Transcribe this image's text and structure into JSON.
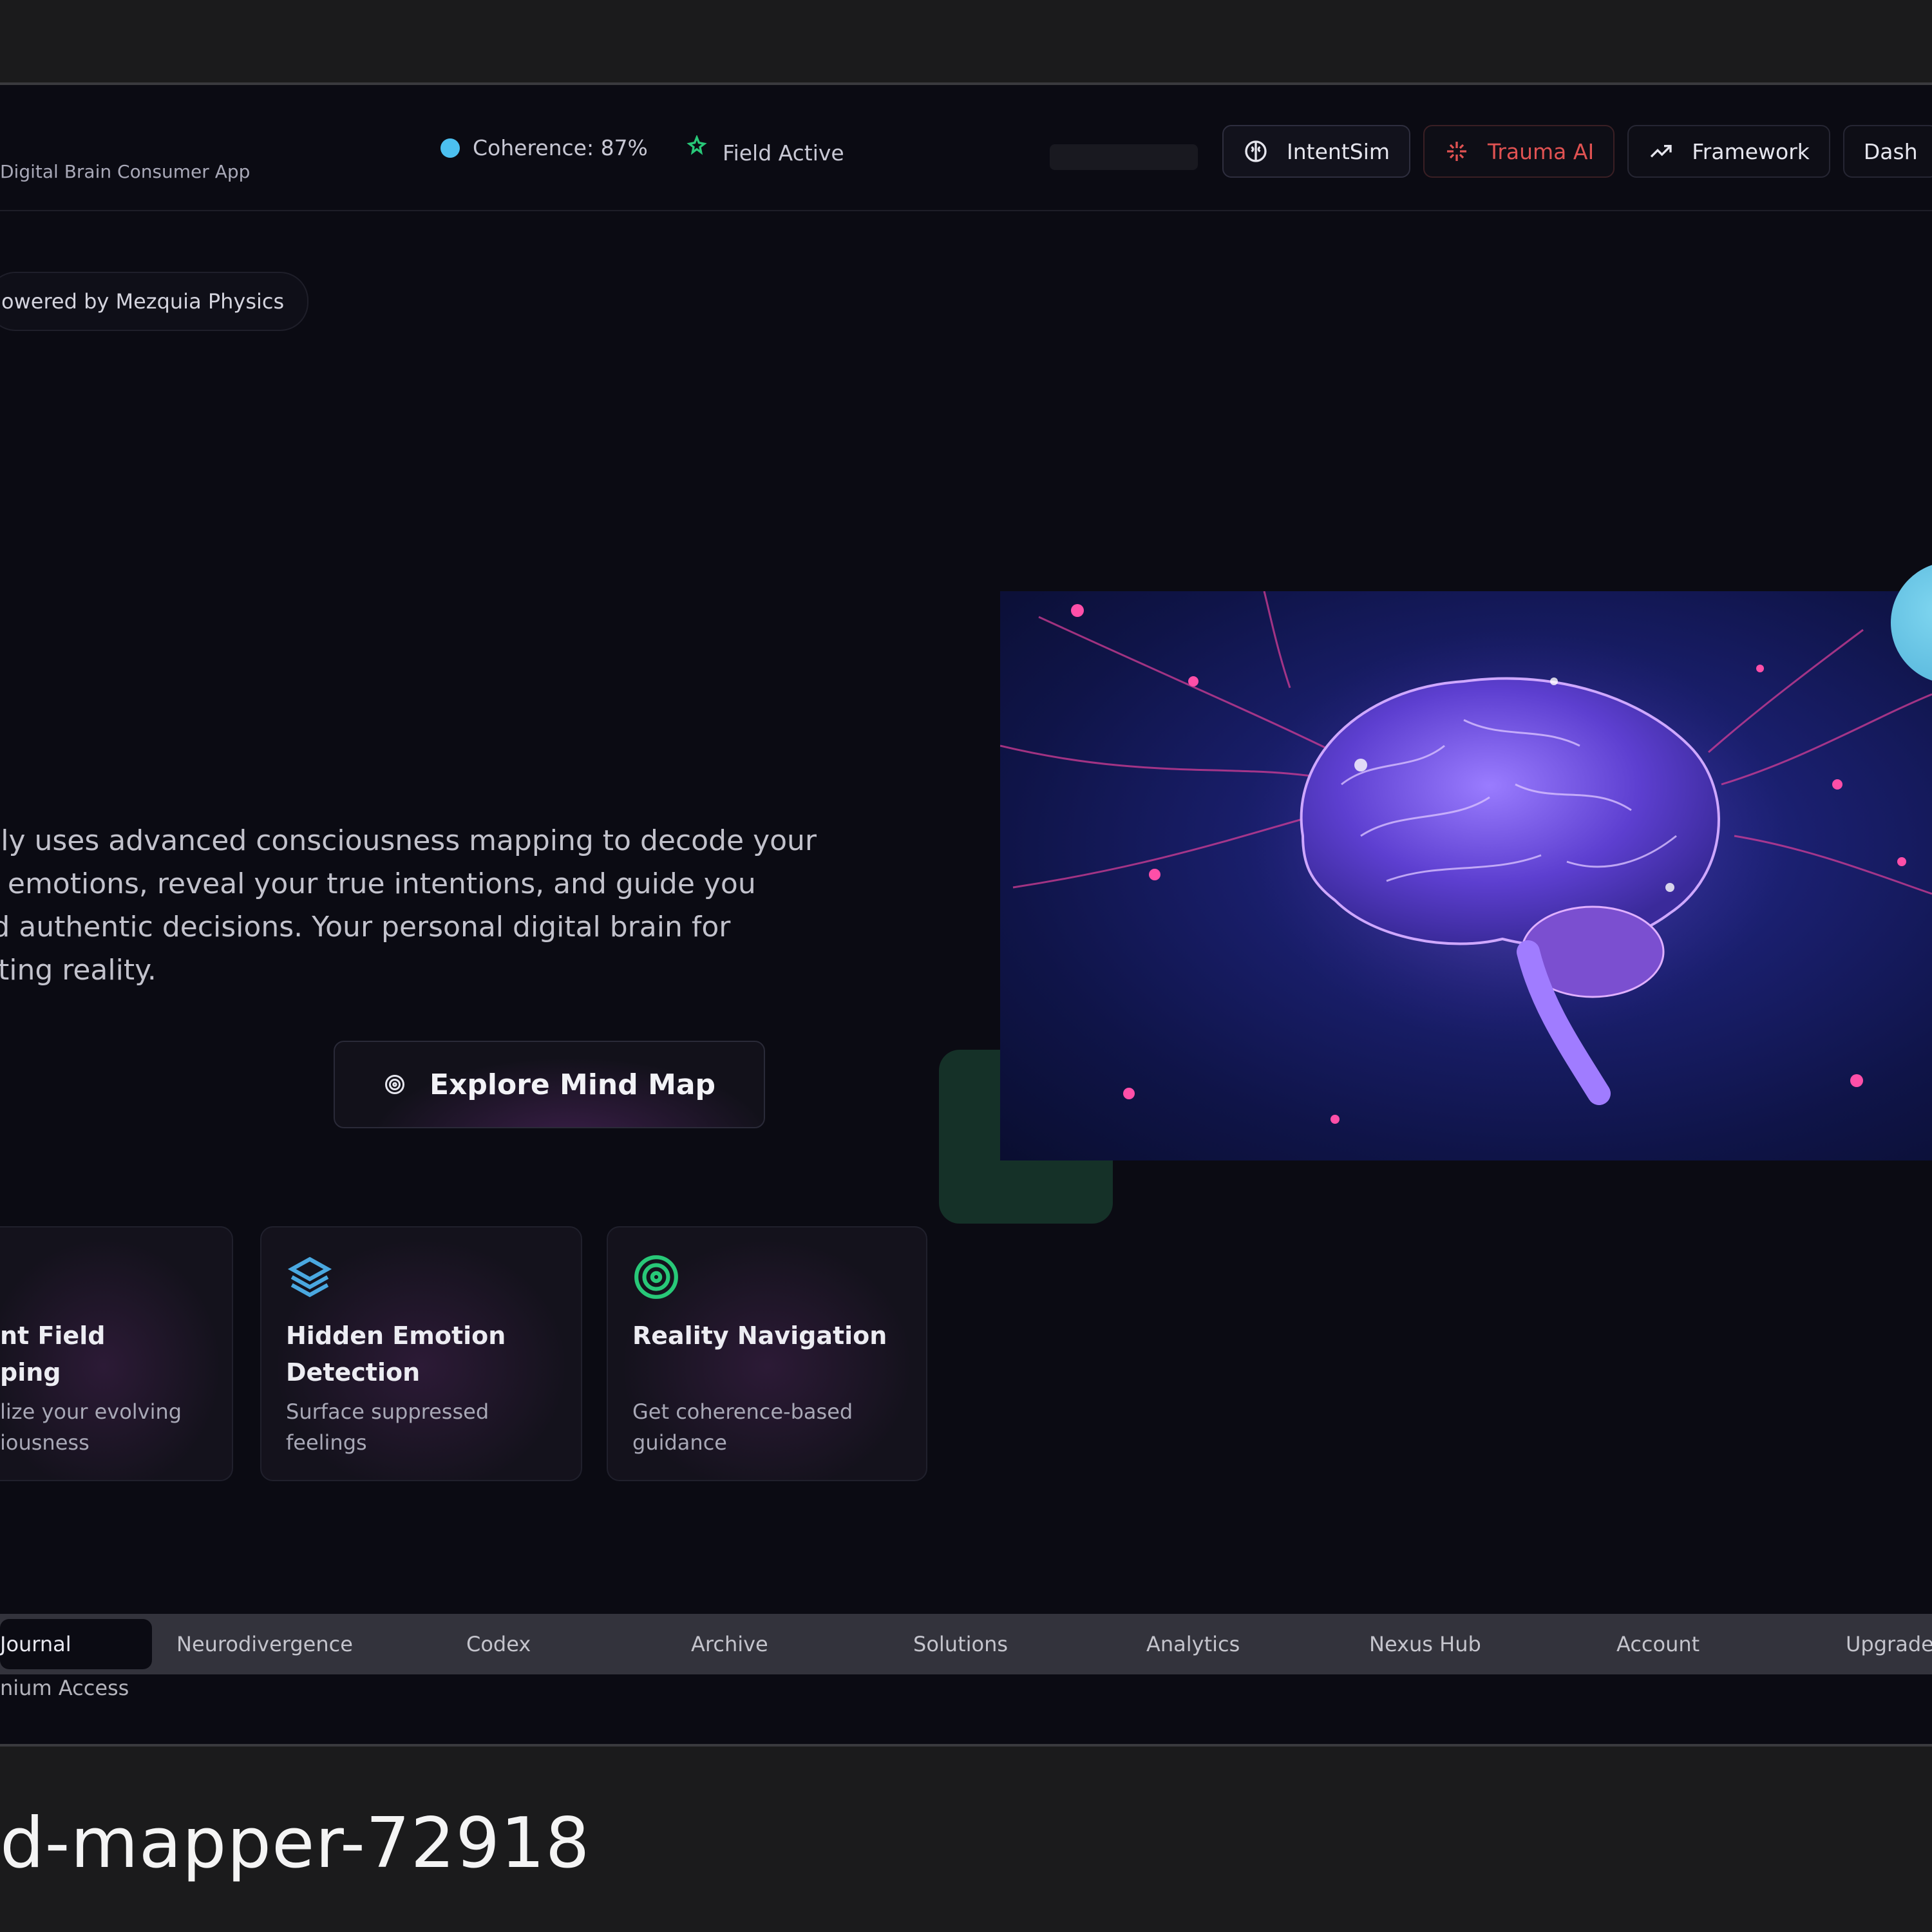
{
  "header": {
    "subtitle": "Digital Brain Consumer App",
    "coherence_label": "Coherence: 87%",
    "field_label": "Field Active",
    "nav_buttons": [
      {
        "label": "IntentSim",
        "icon": "brain-icon"
      },
      {
        "label": "Trauma AI",
        "icon": "sparkle-icon"
      },
      {
        "label": "Framework",
        "icon": "trending-up-icon"
      },
      {
        "label": "Dash",
        "icon": ""
      }
    ]
  },
  "hero": {
    "badge": "owered by Mezquia Physics",
    "description": "t.ly uses advanced consciousness mapping to decode your\nn emotions, reveal your true intentions, and guide you\nrd authentic decisions. Your personal digital brain for\nating reality.",
    "cta_label": "Explore Mind Map"
  },
  "features": [
    {
      "title": "nt Field\nping",
      "desc": "lize your evolving\niousness",
      "icon": ""
    },
    {
      "title": "Hidden Emotion Detection",
      "desc": "Surface suppressed feelings",
      "icon": "layers-icon"
    },
    {
      "title": "Reality Navigation",
      "desc": "Get coherence-based guidance",
      "icon": "target-icon"
    }
  ],
  "tabs": [
    "Journal",
    "Neurodivergence",
    "Codex",
    "Archive",
    "Solutions",
    "Analytics",
    "Nexus Hub",
    "Account",
    "Upgrade"
  ],
  "premium_label": "nium Access",
  "caption": "d-mapper-72918",
  "colors": {
    "accent_blue": "#4cc0f0",
    "trauma_red": "#e05252",
    "green": "#28c878",
    "layers_blue": "#4aa8e0"
  }
}
